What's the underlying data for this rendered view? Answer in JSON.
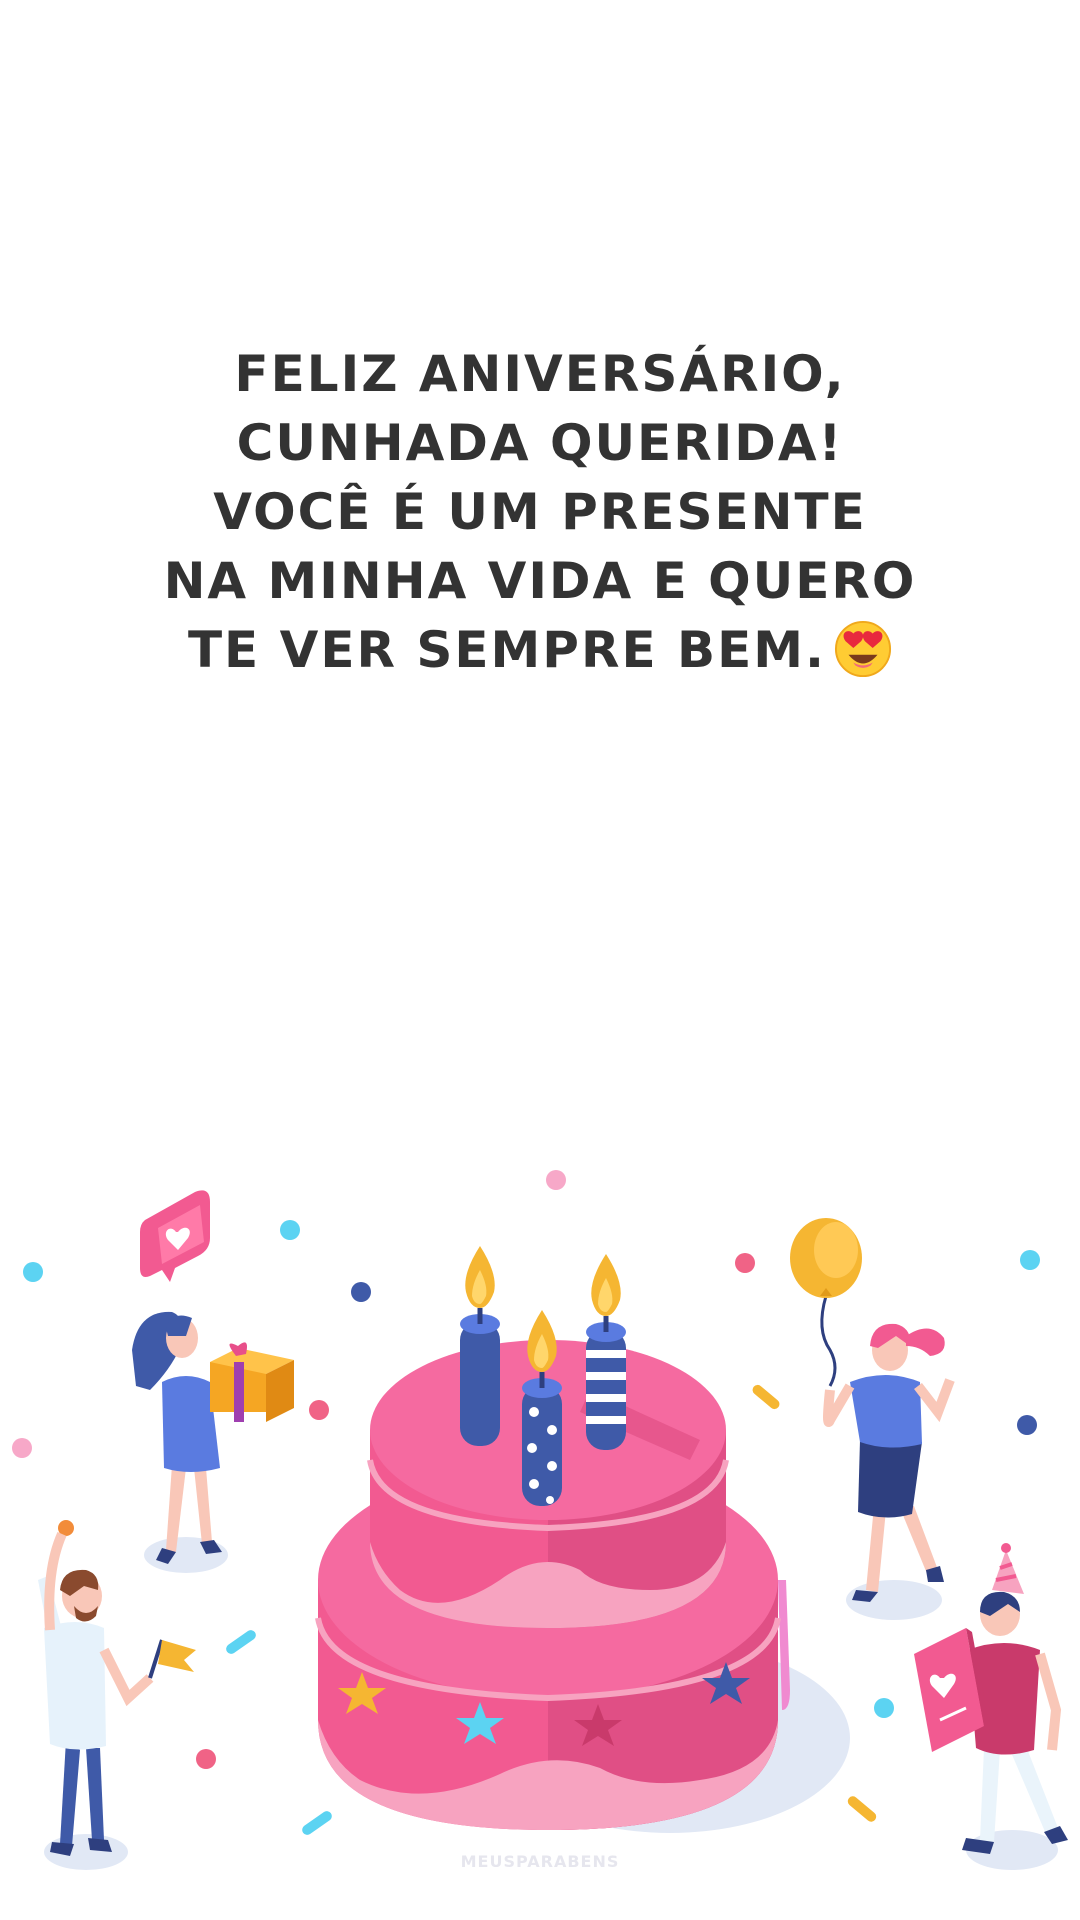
{
  "message": {
    "lines": [
      "FELIZ ANIVERSÁRIO,",
      "CUNHADA QUERIDA!",
      "VOCÊ É UM PRESENTE",
      "NA MINHA VIDA E QUERO",
      "TE VER SEMPRE BEM."
    ],
    "emoji": "heart-eyes-emoji"
  },
  "illustration": {
    "subject": "birthday-party",
    "icons": [
      "birthday-cake-icon",
      "candle-icon",
      "gift-icon",
      "balloon-icon",
      "party-hat-icon",
      "love-card-icon",
      "heart-notification-icon",
      "flag-icon",
      "confetti-icon"
    ],
    "colors": {
      "cake": "#f25a91",
      "candles": "#3f5aa8",
      "flame": "#f5b632",
      "text": "#333333"
    }
  },
  "watermark": "MEUSPARABENS"
}
